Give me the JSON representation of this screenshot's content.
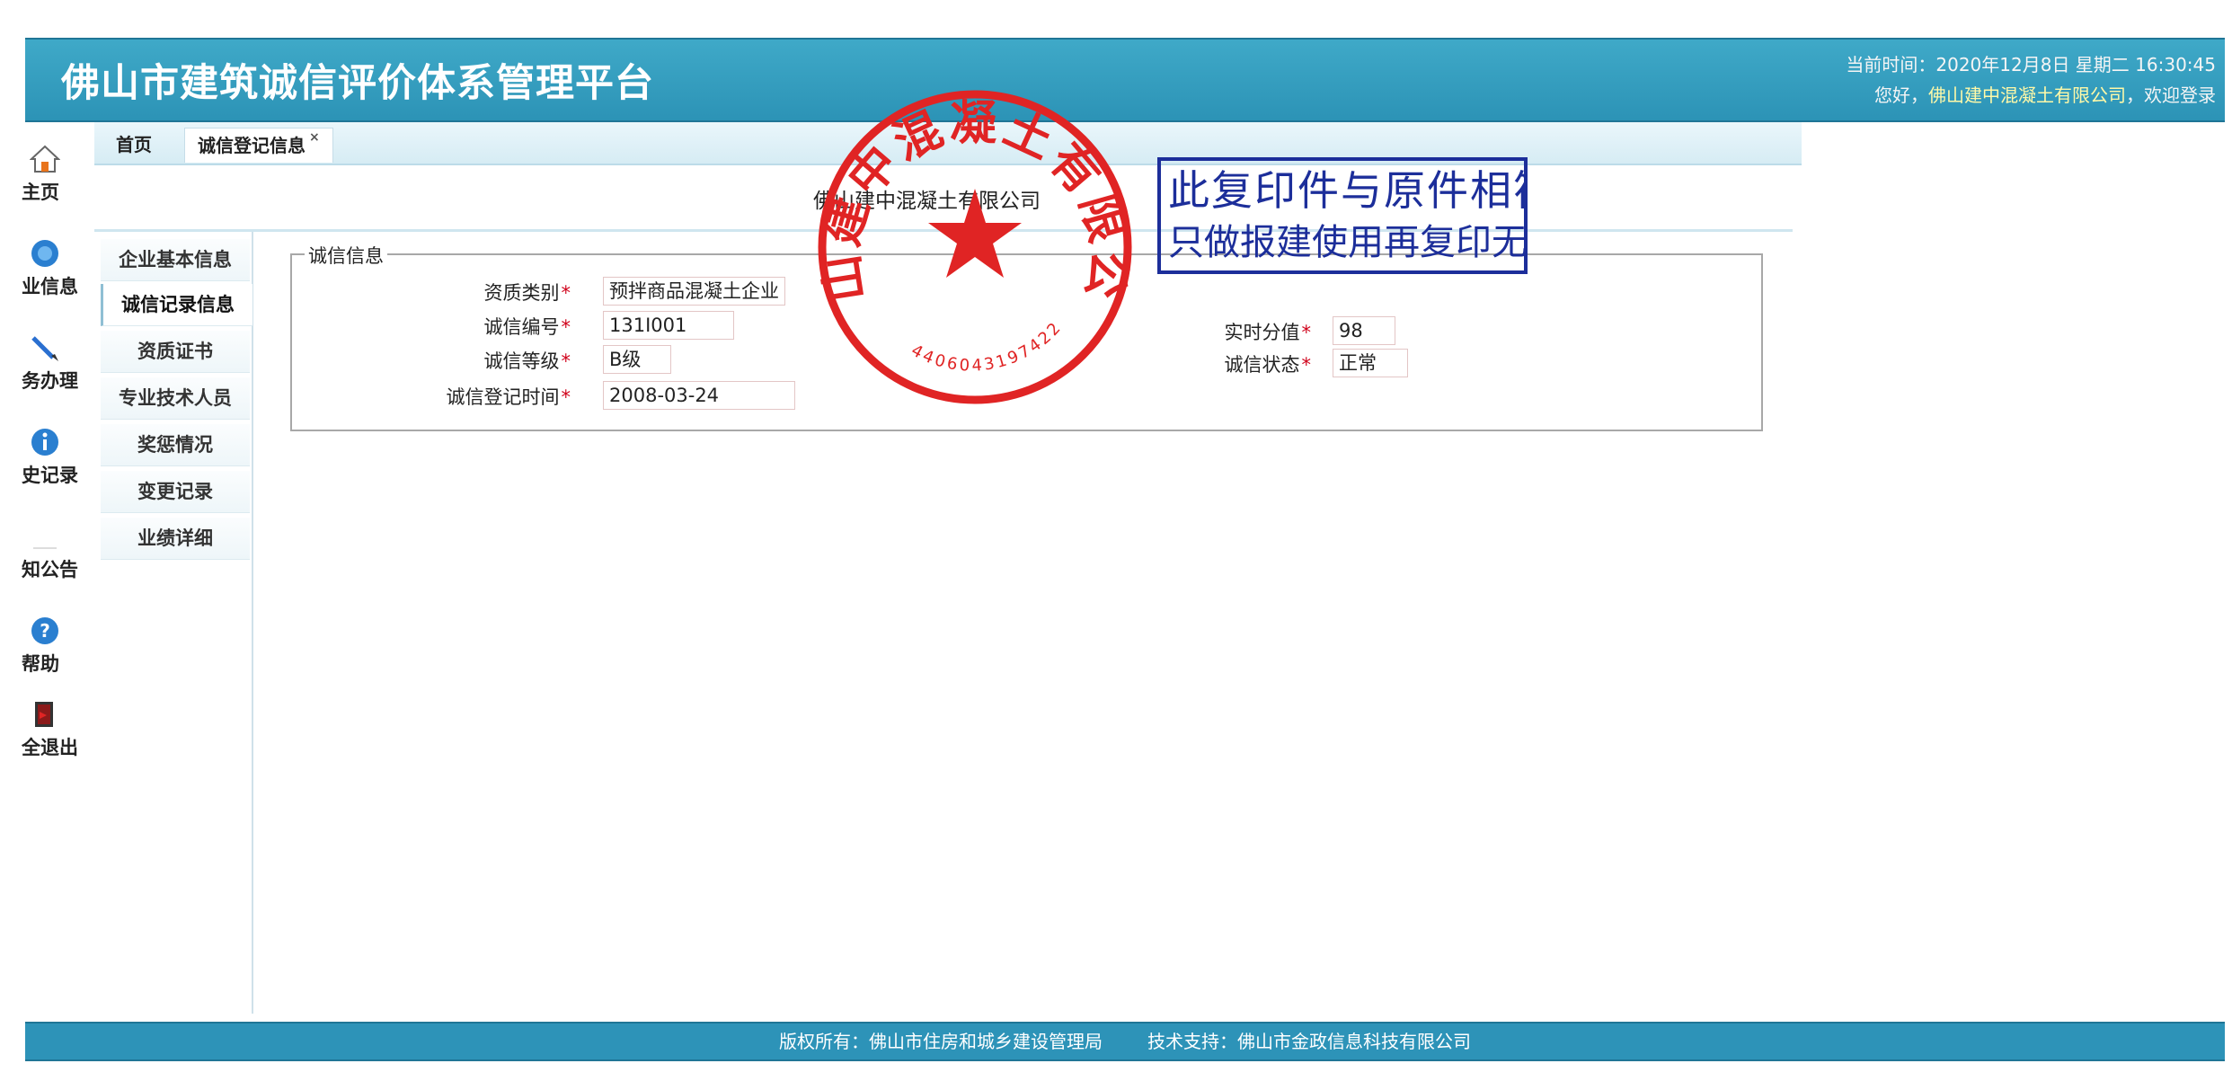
{
  "header": {
    "title": "佛山市建筑诚信评价体系管理平台",
    "current_time": "当前时间：2020年12月8日 星期二 16:30:45",
    "welcome_prefix": "您好，",
    "welcome_user": "佛山建中混凝土有限公司",
    "welcome_suffix": "，欢迎登录"
  },
  "sidebar": {
    "items": [
      {
        "label": "主页",
        "icon": "home-icon"
      },
      {
        "label": "业信息",
        "icon": "company-icon"
      },
      {
        "label": "务办理",
        "icon": "pencil-icon"
      },
      {
        "label": "史记录",
        "icon": "info-icon"
      },
      {
        "label": "知公告",
        "icon": "notice-icon"
      },
      {
        "label": "帮助",
        "icon": "help-icon"
      },
      {
        "label": "全退出",
        "icon": "exit-icon"
      }
    ]
  },
  "tabs": {
    "home": "首页",
    "credit": "诚信登记信息",
    "close": "×"
  },
  "company_name": "佛山建中混凝土有限公司",
  "sub_nav": {
    "items": [
      "企业基本信息",
      "诚信记录信息",
      "资质证书",
      "专业技术人员",
      "奖惩情况",
      "变更记录",
      "业绩详细"
    ]
  },
  "form": {
    "legend": "诚信信息",
    "required_mark": "*",
    "qualification_type_label": "资质类别",
    "qualification_type_value": "预拌商品混凝土企业",
    "credit_no_label": "诚信编号",
    "credit_no_value": "131I001",
    "credit_grade_label": "诚信等级",
    "credit_grade_value": "B级",
    "reg_time_label": "诚信登记时间",
    "reg_time_value": "2008-03-24",
    "score_label": "实时分值",
    "score_value": "98",
    "status_label": "诚信状态",
    "status_value": "正常"
  },
  "stamps": {
    "seal_text": "佛山建中混凝土有限公司",
    "seal_number": "4406043197422",
    "copy_line1": "此复印件与原件相符",
    "copy_line2": "只做报建使用再复印无效"
  },
  "footer": {
    "copyright": "版权所有：佛山市住房和城乡建设管理局",
    "support": "技术支持：佛山市金政信息科技有限公司"
  },
  "colors": {
    "header_bg": "#2c93b6",
    "footer_bg": "#2d93b8",
    "seal_red": "#e02424",
    "stamp_blue": "#1c2e9a",
    "required": "#d0021b"
  }
}
